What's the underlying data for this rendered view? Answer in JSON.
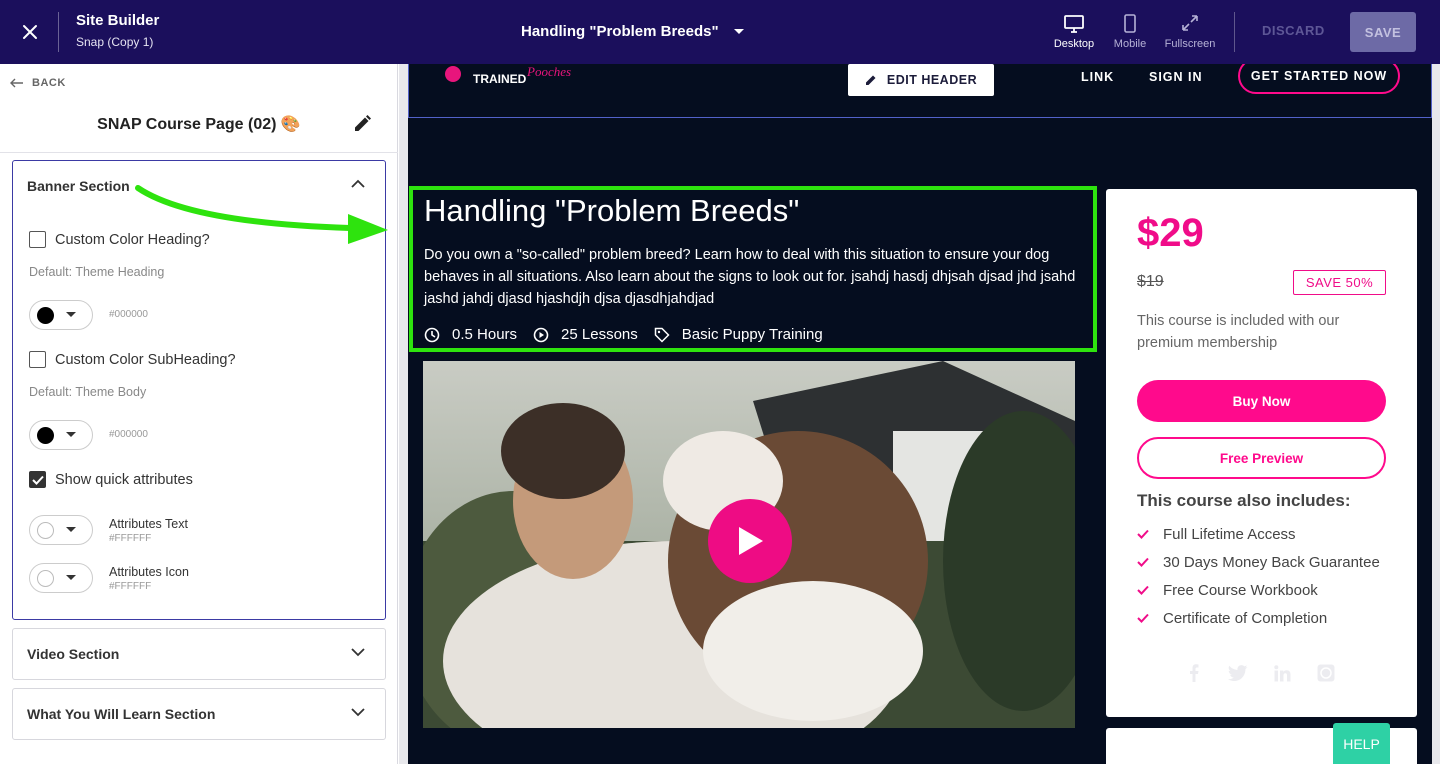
{
  "topbar": {
    "app_title": "Site Builder",
    "app_subtitle": "Snap (Copy 1)",
    "page_selector": "Handling \"Problem Breeds\"",
    "views": [
      {
        "label": "Desktop",
        "icon": "desktop-icon",
        "active": true
      },
      {
        "label": "Mobile",
        "icon": "mobile-icon",
        "active": false
      },
      {
        "label": "Fullscreen",
        "icon": "fullscreen-icon",
        "active": false
      }
    ],
    "discard_label": "DISCARD",
    "save_label": "SAVE"
  },
  "sidebar": {
    "back_label": "BACK",
    "page_name": "SNAP Course Page (02) 🎨",
    "banner_section": {
      "title": "Banner Section",
      "custom_heading_label": "Custom Color Heading?",
      "custom_heading_checked": false,
      "heading_default": "Default: Theme Heading",
      "heading_color": "#000000",
      "custom_subheading_label": "Custom Color SubHeading?",
      "custom_subheading_checked": false,
      "subheading_default": "Default: Theme Body",
      "subheading_color": "#000000",
      "quick_attributes_label": "Show quick attributes",
      "quick_attributes_checked": true,
      "attributes_text_label": "Attributes Text",
      "attributes_text_color": "#FFFFFF",
      "attributes_icon_label": "Attributes Icon",
      "attributes_icon_color": "#FFFFFF"
    },
    "video_section": {
      "title": "Video Section"
    },
    "learn_section": {
      "title": "What You Will Learn Section"
    }
  },
  "preview": {
    "header": {
      "edit_header_label": "EDIT HEADER",
      "logo_text_1": "TRAINED",
      "logo_text_2": "Pooches",
      "nav_links": [
        "LINK",
        "SIGN IN"
      ],
      "cta_label": "GET STARTED NOW"
    },
    "banner": {
      "title": "Handling \"Problem Breeds\"",
      "description": "Do you own a \"so-called\" problem breed? Learn how to deal with this situation to ensure your dog behaves in all situations. Also learn about the signs to look out for. jsahdj hasdj dhjsah djsad jhd jsahd jashd jahdj djasd hjashdjh djsa djasdhjahdjad",
      "duration": "0.5 Hours",
      "lessons": "25 Lessons",
      "category": "Basic Puppy Training"
    },
    "card": {
      "price": "$29",
      "old_price": "$19",
      "save_badge": "SAVE 50%",
      "included_text": "This course is included with our premium membership",
      "buy_label": "Buy Now",
      "preview_label": "Free Preview",
      "includes_title": "This course also includes:",
      "includes": [
        "Full Lifetime Access",
        "30 Days Money Back Guarantee",
        "Free Course Workbook",
        "Certificate of Completion"
      ],
      "social_icons": [
        "facebook-icon",
        "twitter-icon",
        "linkedin-icon",
        "whatsapp-icon"
      ]
    }
  },
  "help_label": "HELP",
  "colors": {
    "topbar": "#1b0f5c",
    "accent_pink": "#ff0a8c",
    "highlight_green": "#2ee30e",
    "preview_bg": "#050d1f",
    "help": "#2ed1a5"
  }
}
